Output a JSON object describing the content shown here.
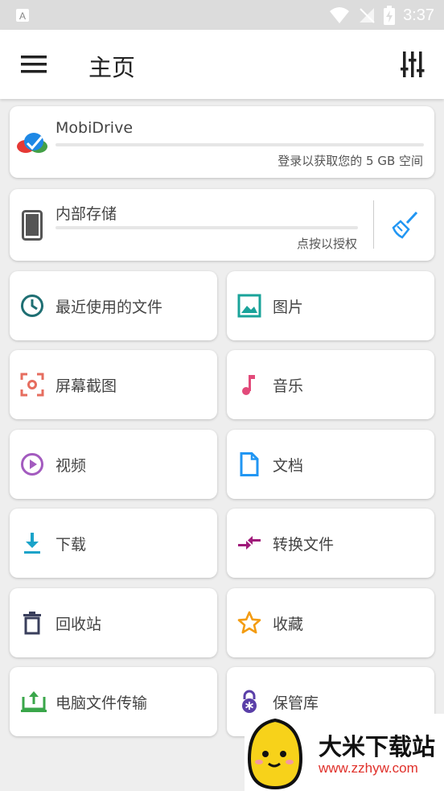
{
  "status_bar": {
    "time": "3:37"
  },
  "app_bar": {
    "title": "主页"
  },
  "mobidrive": {
    "title": "MobiDrive",
    "subtitle": "登录以获取您的 5 GB 空间"
  },
  "internal_storage": {
    "title": "内部存储",
    "subtitle": "点按以授权"
  },
  "tiles": [
    {
      "label": "最近使用的文件",
      "icon": "clock-icon",
      "color": "#1f6f73"
    },
    {
      "label": "图片",
      "icon": "image-icon",
      "color": "#1aa39a"
    },
    {
      "label": "屏幕截图",
      "icon": "screenshot-icon",
      "color": "#e66d5f"
    },
    {
      "label": "音乐",
      "icon": "music-note-icon",
      "color": "#e24a7a"
    },
    {
      "label": "视频",
      "icon": "play-circle-icon",
      "color": "#a35bbf"
    },
    {
      "label": "文档",
      "icon": "document-icon",
      "color": "#2196f3"
    },
    {
      "label": "下载",
      "icon": "download-icon",
      "color": "#1aa3c9"
    },
    {
      "label": "转换文件",
      "icon": "convert-icon",
      "color": "#a01a7a"
    },
    {
      "label": "回收站",
      "icon": "trash-icon",
      "color": "#3a3f5c"
    },
    {
      "label": "收藏",
      "icon": "star-icon",
      "color": "#f39c12"
    },
    {
      "label": "电脑文件传输",
      "icon": "pc-transfer-icon",
      "color": "#3aa64a"
    },
    {
      "label": "保管库",
      "icon": "vault-lock-icon",
      "color": "#5a3fa8"
    }
  ],
  "watermark": {
    "text": "大米下载站",
    "url": "www.zzhyw.com"
  }
}
